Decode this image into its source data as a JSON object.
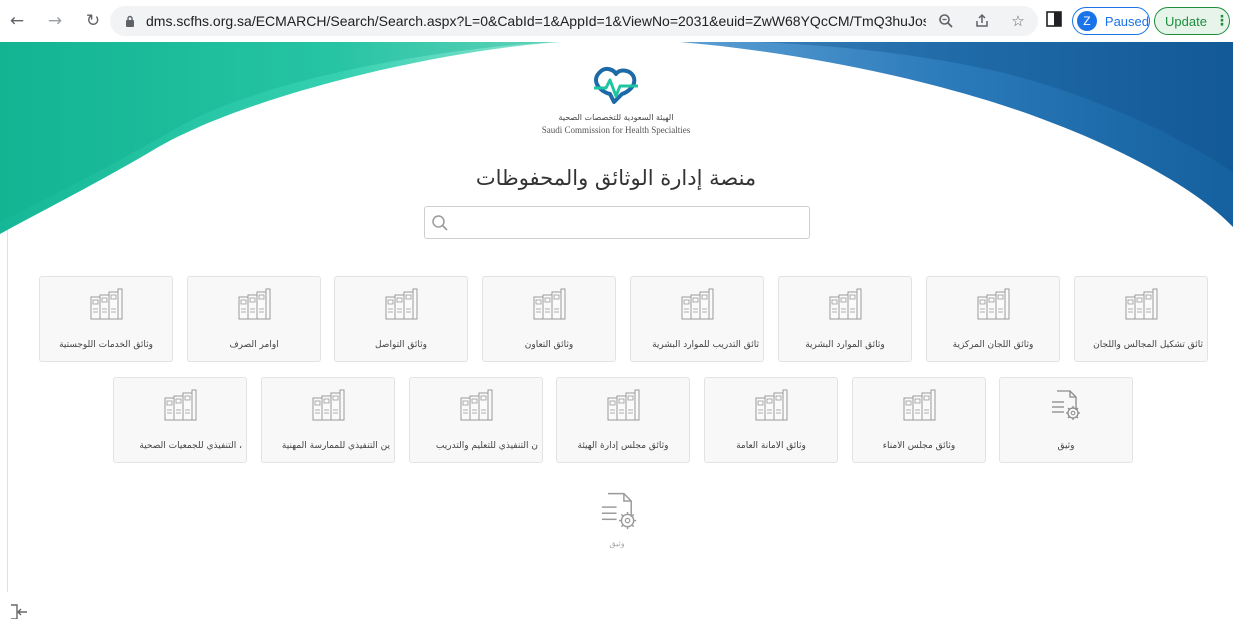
{
  "browser": {
    "url": "dms.scfhs.org.sa/ECMARCH/Search/Search.aspx?L=0&CabId=1&AppId=1&ViewNo=2031&euid=ZwW68YQcCM/TmQ3huJosSQ==...",
    "profile_initial": "Z",
    "profile_label": "Paused",
    "update_label": "Update"
  },
  "header": {
    "org_name_ar": "الهيئة السعودية للتخصصات الصحية",
    "org_name_en": "Saudi Commission for Health Specialties",
    "page_title": "منصة إدارة الوثائق والمحفوظات"
  },
  "search": {
    "placeholder": ""
  },
  "tiles_row1": [
    {
      "label": "ثائق تشكيل المجالس واللجان"
    },
    {
      "label": "وثائق اللجان المركزية"
    },
    {
      "label": "وثائق الموارد البشرية"
    },
    {
      "label": "ثائق التدريب للموارد البشرية"
    },
    {
      "label": "وثائق التعاون"
    },
    {
      "label": "وثائق التواصل"
    },
    {
      "label": "اوامر الصرف"
    },
    {
      "label": "وثائق الخدمات اللوجستية"
    }
  ],
  "tiles_row2": [
    {
      "label": "وثيق"
    },
    {
      "label": "وثائق مجلس الأمناء"
    },
    {
      "label": "وثائق الأمانة العامة"
    },
    {
      "label": "وثائق مجلس إدارة الهيئة"
    },
    {
      "label": "ن التنفيذي للتعليم والتدريب"
    },
    {
      "label": "ين التنفيذي للممارسة المهنية"
    },
    {
      "label": "، التنفيذي للجمعيات الصحية"
    }
  ],
  "tile_last": {
    "label": "وثيق"
  },
  "colors": {
    "teal": "#1fc4a0",
    "blue": "#1d6aa8",
    "accent": "#1a73e8"
  }
}
